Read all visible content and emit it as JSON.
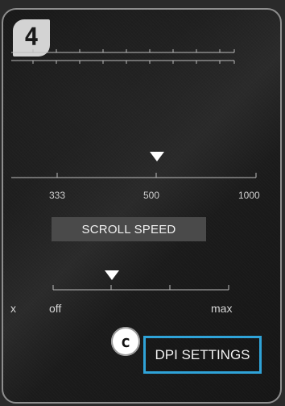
{
  "step_badge": {
    "label": "4"
  },
  "dpi_slider": {
    "ticks": [
      "333",
      "500",
      "1000"
    ]
  },
  "scroll_speed": {
    "title": "SCROLL SPEED",
    "left_edge_text": "x",
    "min_label": "off",
    "max_label": "max"
  },
  "callout": {
    "label": "c"
  },
  "dpi_settings_button": {
    "label": "DPI SETTINGS"
  },
  "colors": {
    "highlight": "#2fa3d8",
    "panel_border": "#8e8e8e",
    "label_bg": "#4a4a4a"
  },
  "icons": {
    "dpi_pointer": "triangle-down",
    "scroll_pointer": "triangle-down"
  }
}
